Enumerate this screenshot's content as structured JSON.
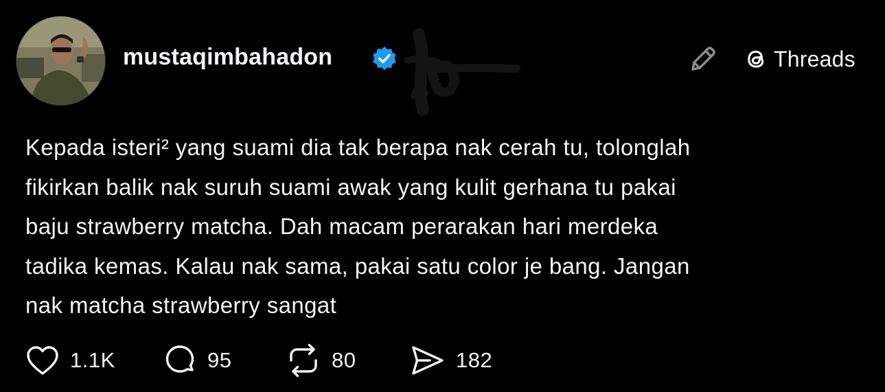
{
  "post": {
    "username": "mustaqimbahadon",
    "verified": true,
    "platform_label": "Threads",
    "text": "Kepada isteri² yang suami dia tak berapa nak cerah tu, tolonglah\nfikirkan balik nak suruh suami awak yang kulit gerhana tu pakai\nbaju strawberry matcha. Dah macam perarakan hari merdeka\ntadika kemas. Kalau nak sama, pakai satu color je bang. Jangan\nnak matcha strawberry sangat",
    "actions": {
      "like": {
        "icon": "heart-icon",
        "count": "1.1K"
      },
      "reply": {
        "icon": "comment-icon",
        "count": "95"
      },
      "repost": {
        "icon": "repost-icon",
        "count": "80"
      },
      "share": {
        "icon": "send-icon",
        "count": "182"
      }
    }
  },
  "colors": {
    "background": "#000000",
    "text": "#f3f5f7",
    "verified_blue": "#1d9bf0",
    "icon_gray": "#8e8e8e"
  }
}
